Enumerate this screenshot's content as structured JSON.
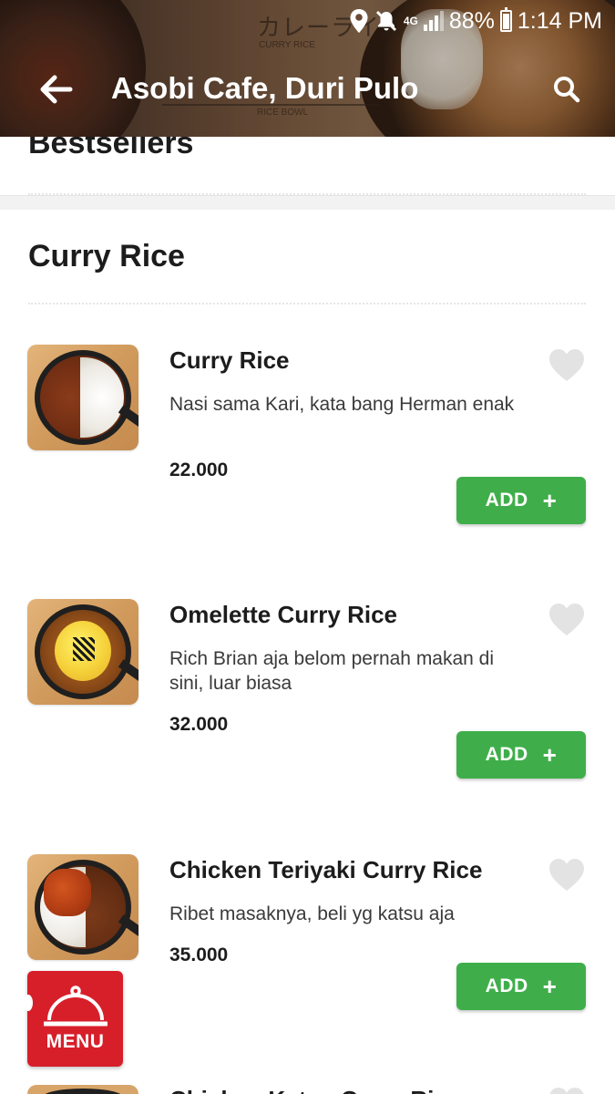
{
  "status_bar": {
    "network": "4G",
    "battery": "88%",
    "time": "1:14 PM"
  },
  "header": {
    "title": "Asobi Cafe, Duri Pulo",
    "banner_text_jp": "カレーライス",
    "banner_text_sub": "CURRY RICE",
    "banner_text_bottom": "RICE BOWL"
  },
  "sections": {
    "bestsellers_title": "Bestsellers",
    "curry_rice_title": "Curry Rice"
  },
  "items": [
    {
      "name": "Curry Rice",
      "description": "Nasi sama Kari, kata bang Herman enak",
      "price": "22.000",
      "add_label": "ADD",
      "add_symbol": "+",
      "favorited": false
    },
    {
      "name": "Omelette Curry Rice",
      "description": "Rich Brian aja belom pernah makan di sini, luar biasa",
      "price": "32.000",
      "add_label": "ADD",
      "add_symbol": "+",
      "favorited": false
    },
    {
      "name": "Chicken Teriyaki Curry Rice",
      "description": "Ribet masaknya, beli yg katsu aja",
      "price": "35.000",
      "add_label": "ADD",
      "add_symbol": "+",
      "favorited": false
    },
    {
      "name": "Chicken Katsu Curry Rice"
    }
  ],
  "menu_button": {
    "label": "MENU"
  },
  "colors": {
    "add_button": "#3fae4a",
    "menu_button": "#d71f2a",
    "favorite_icon": "#e3e3e3"
  }
}
